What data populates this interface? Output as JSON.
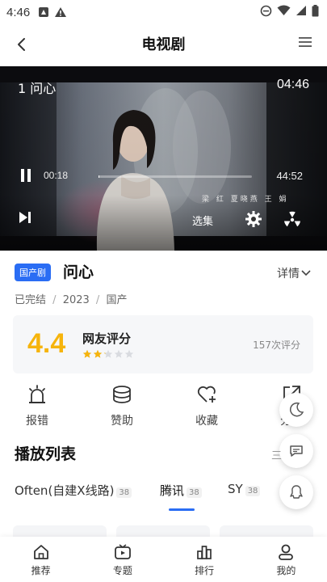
{
  "status_bar": {
    "time": "4:46"
  },
  "header": {
    "title": "电视剧"
  },
  "player": {
    "episode_title": "1 问心",
    "clock": "04:46",
    "current_time": "00:18",
    "duration": "44:52",
    "progress": 0.007,
    "episodes_label": "选集",
    "credits_text": "梁 红 夏晓燕 王 娟"
  },
  "show": {
    "tag": "国产剧",
    "name": "问心",
    "details_label": "详情",
    "status": "已完结",
    "year": "2023",
    "region": "国产",
    "sep": "/"
  },
  "rating": {
    "score": "4.4",
    "label": "网友评分",
    "count": "157次评分",
    "stars_filled": 2.2,
    "stars_total": 5
  },
  "actions": [
    {
      "label": "报错",
      "icon": "alarm-icon"
    },
    {
      "label": "赞助",
      "icon": "coins-icon"
    },
    {
      "label": "收藏",
      "icon": "heart-plus-icon"
    },
    {
      "label": "分享",
      "icon": "share-icon"
    }
  ],
  "playlist": {
    "title": "播放列表",
    "more": "三",
    "sources": [
      {
        "name": "Often(自建X线路)",
        "count": "38"
      },
      {
        "name": "腾讯",
        "count": "38",
        "active": true
      },
      {
        "name": "SY",
        "count": "38"
      }
    ]
  },
  "bottom_nav": [
    {
      "label": "推荐",
      "icon": "home-icon"
    },
    {
      "label": "专题",
      "icon": "tv-icon"
    },
    {
      "label": "排行",
      "icon": "ranking-icon"
    },
    {
      "label": "我的",
      "icon": "profile-icon"
    }
  ],
  "colors": {
    "accent": "#2a6df4",
    "rating": "#f6b40c"
  }
}
